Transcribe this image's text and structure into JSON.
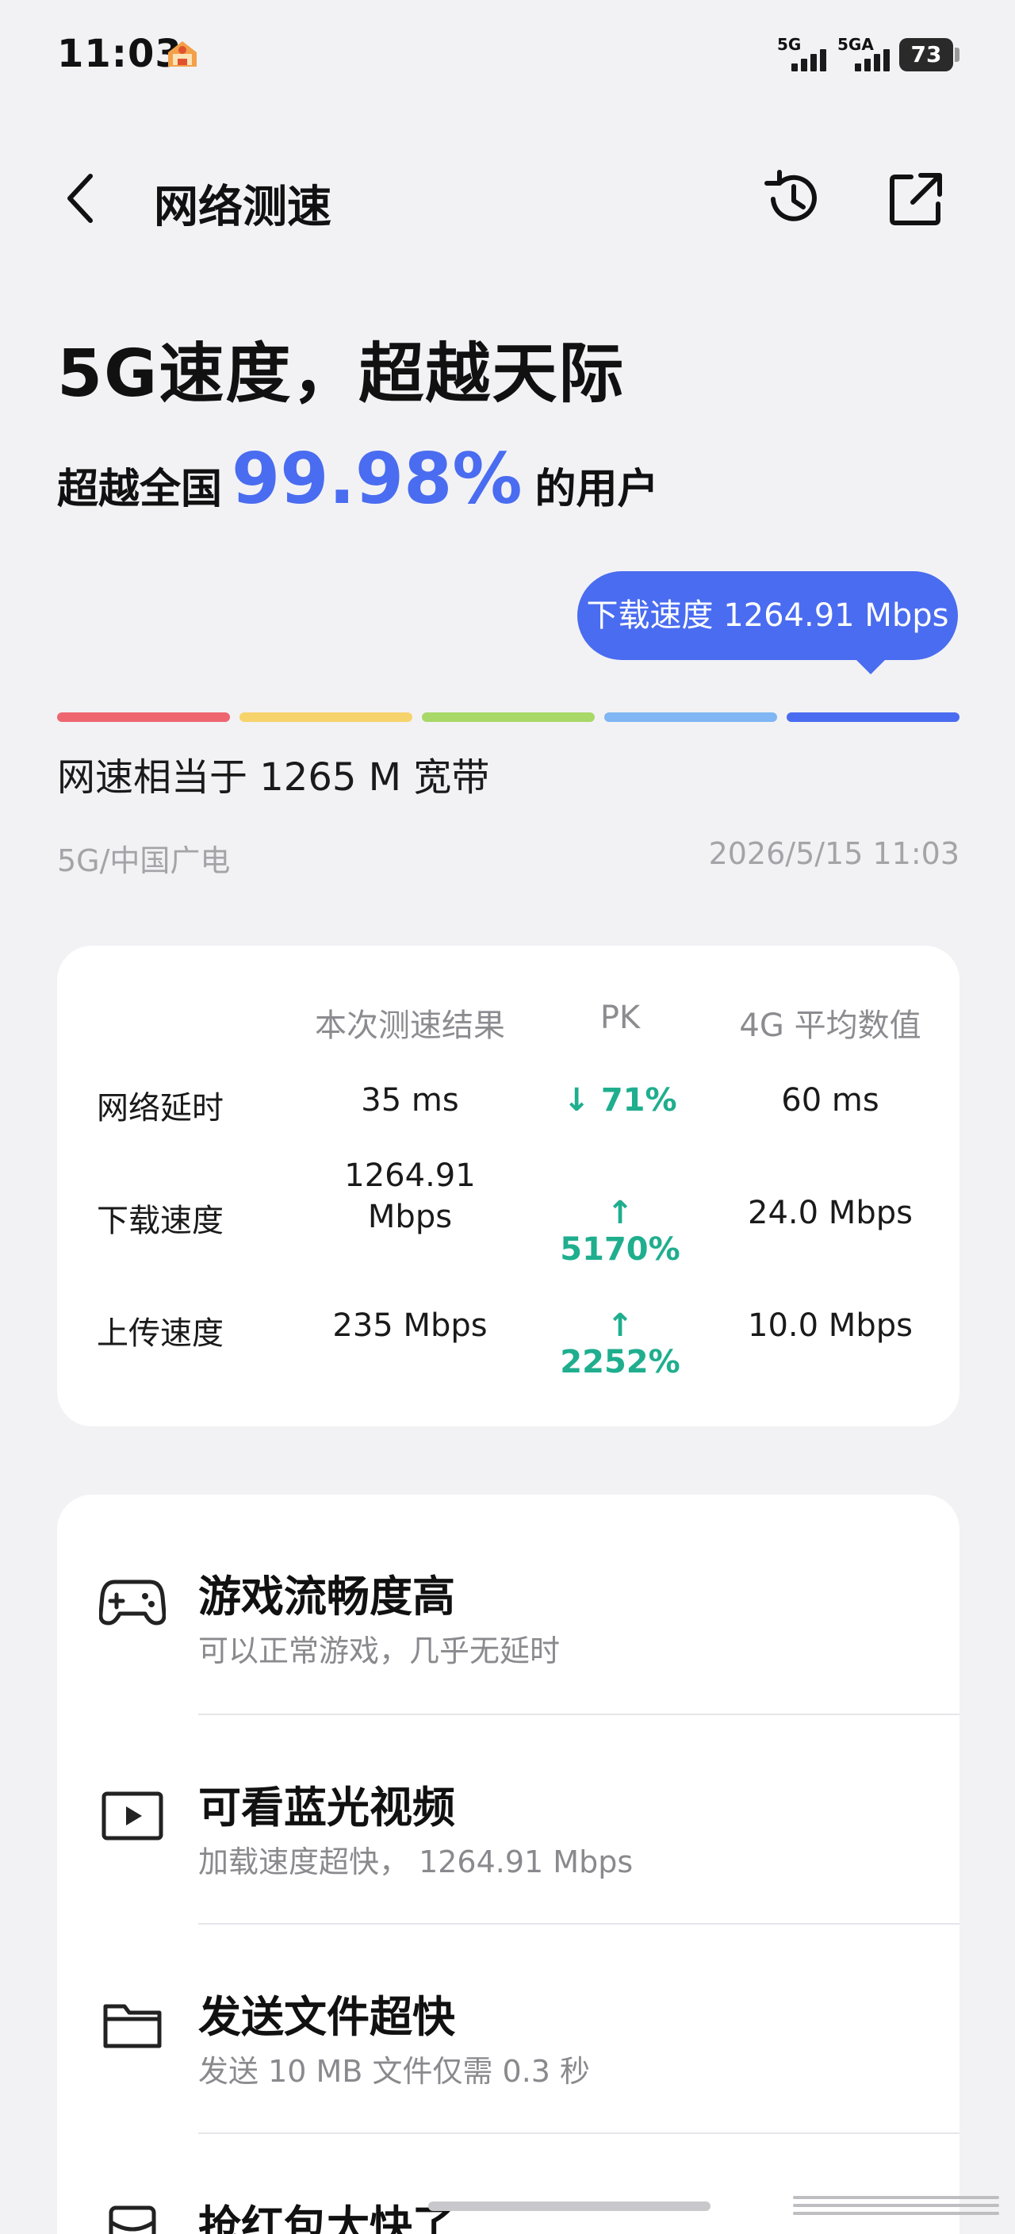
{
  "status_bar": {
    "time": "11:03",
    "signal_1_label": "5G",
    "signal_2_label": "5GA",
    "battery": "73"
  },
  "header": {
    "title": "网络测速",
    "back_icon": "chevron-left-icon",
    "history_icon": "history-clock-icon",
    "share_icon": "share-external-icon"
  },
  "hero": {
    "headline": "5G速度，超越天际",
    "rank_prefix": "超越全国",
    "rank_percent": "99.98%",
    "rank_suffix": "的用户",
    "speed_bubble": "下载速度 1264.91 Mbps",
    "scale_colors": [
      "#ee6670",
      "#f7d36c",
      "#a8d867",
      "#7fb6f3",
      "#4a6cf0"
    ],
    "broadband_text": "网速相当于 1265 M 宽带",
    "network": "5G/中国广电",
    "tested_at": "2026/5/15 11:03"
  },
  "comparison": {
    "headers": {
      "result": "本次测速结果",
      "pk": "PK",
      "average": "4G 平均数值"
    },
    "rows": [
      {
        "label": "网络延时",
        "result": "35 ms",
        "pk_arrow": "↓",
        "pk": "71%",
        "average": "60 ms"
      },
      {
        "label": "下载速度",
        "result_line1": "1264.91",
        "result_line2": "Mbps",
        "pk_arrow": "↑",
        "pk": "5170%",
        "average": "24.0 Mbps"
      },
      {
        "label": "上传速度",
        "result": "235 Mbps",
        "pk_arrow": "↑",
        "pk": "2252%",
        "average": "10.0 Mbps"
      }
    ],
    "pk_color": "#1fae8e"
  },
  "features": [
    {
      "icon": "gamepad-icon",
      "title": "游戏流畅度高",
      "subtitle": "可以正常游戏，几乎无延时"
    },
    {
      "icon": "play-video-icon",
      "title": "可看蓝光视频",
      "subtitle": "加载速度超快，  1264.91 Mbps"
    },
    {
      "icon": "folder-icon",
      "title": "发送文件超快",
      "subtitle": "发送 10 MB 文件仅需 0.3 秒"
    },
    {
      "icon": "red-packet-icon",
      "title": "抢红包太快了",
      "subtitle": ""
    }
  ],
  "accent_color": "#4a6cf0"
}
